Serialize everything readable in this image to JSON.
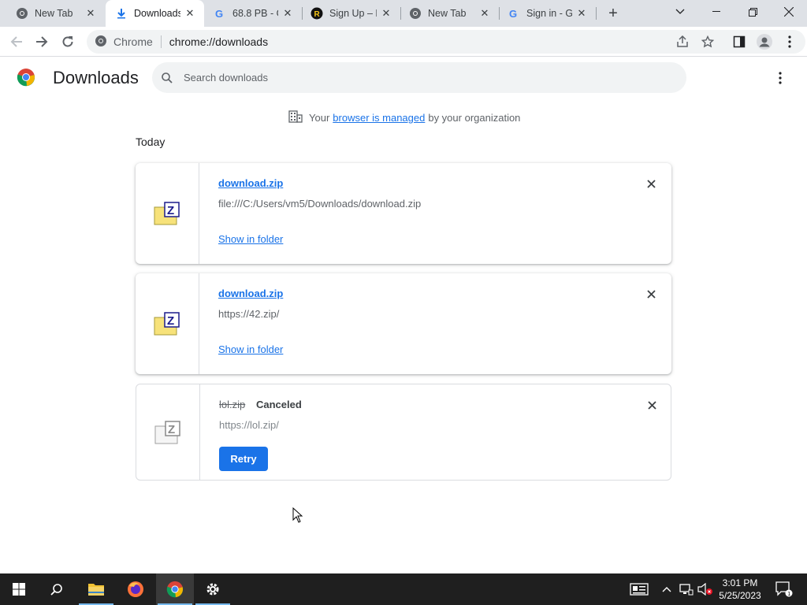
{
  "tabs": [
    {
      "title": "New Tab",
      "favicon": "chrome-icon",
      "active": false
    },
    {
      "title": "Downloads",
      "favicon": "download-icon",
      "active": true
    },
    {
      "title": "68.8 PB - G",
      "favicon": "google-icon",
      "active": false
    },
    {
      "title": "Sign Up – R",
      "favicon": "r-circle-icon",
      "active": false
    },
    {
      "title": "New Tab",
      "favicon": "chrome-icon",
      "active": false
    },
    {
      "title": "Sign in - Go",
      "favicon": "google-icon",
      "active": false
    }
  ],
  "toolbar": {
    "site_label": "Chrome",
    "url": "chrome://downloads"
  },
  "page": {
    "title": "Downloads",
    "search_placeholder": "Search downloads",
    "managed_prefix": "Your",
    "managed_link": "browser is managed",
    "managed_suffix": "by your organization",
    "section_label": "Today"
  },
  "downloads": [
    {
      "filename": "download.zip",
      "url": "file:///C:/Users/vm5/Downloads/download.zip",
      "action": "Show in folder",
      "state": "complete"
    },
    {
      "filename": "download.zip",
      "url": "https://42.zip/",
      "action": "Show in folder",
      "state": "complete"
    },
    {
      "filename": "lol.zip",
      "status": "Canceled",
      "url": "https://lol.zip/",
      "action": "Retry",
      "state": "canceled"
    }
  ],
  "taskbar": {
    "time": "3:01 PM",
    "date": "5/25/2023",
    "notification_count": "1"
  },
  "colors": {
    "accent": "#1a73e8",
    "tabstrip": "#dee1e6",
    "taskbar": "#1f1f1f"
  }
}
